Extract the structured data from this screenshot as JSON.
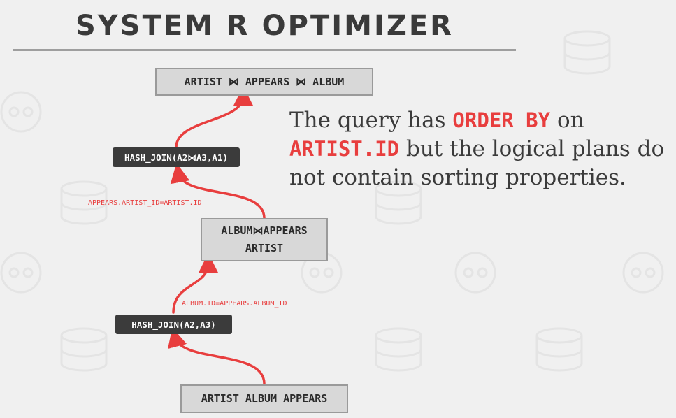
{
  "slide": {
    "title": "SYSTEM R OPTIMIZER"
  },
  "plan": {
    "root_node": "ARTIST ⋈ APPEARS ⋈ ALBUM",
    "hash_join_top": "HASH_JOIN(A2⋈A3,A1)",
    "condition_top": "APPEARS.ARTIST_ID=ARTIST.ID",
    "middle_node_line1": "ALBUM⋈APPEARS",
    "middle_node_line2": "ARTIST",
    "condition_bottom": "ALBUM.ID=APPEARS.ALBUM_ID",
    "hash_join_bottom": "HASH_JOIN(A2,A3)",
    "leaf_node": "ARTIST ALBUM APPEARS"
  },
  "description": {
    "part1": "The query has ",
    "highlight1": "ORDER BY",
    "part2": " on",
    "highlight2": "ARTIST.ID",
    "part3": " but the logical plans do",
    "part4": "not contain sorting properties."
  },
  "colors": {
    "accent_red": "#e83e3e",
    "dark_node": "#3b3b3b",
    "light_node": "#d8d8d8",
    "text_dark": "#3a3a3a"
  },
  "icons": [
    "database-watermark-icon",
    "skull-watermark-icon"
  ]
}
